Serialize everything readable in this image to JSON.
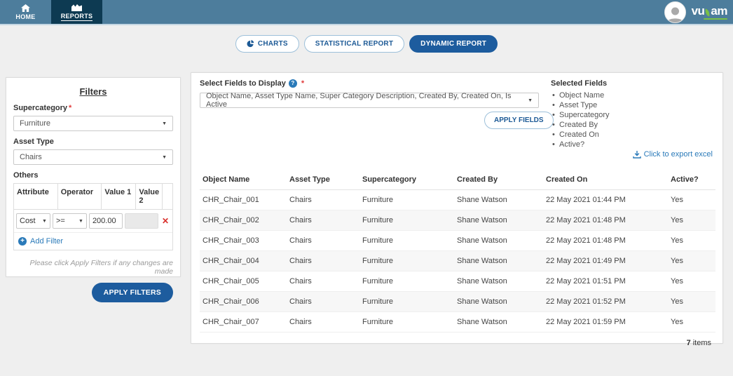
{
  "nav": {
    "home_label": "HOME",
    "reports_label": "REPORTS",
    "brand": {
      "part1": "vu",
      "part2": "am"
    }
  },
  "tabs": {
    "charts": "CHARTS",
    "statistical": "STATISTICAL REPORT",
    "dynamic": "DYNAMIC REPORT"
  },
  "filters": {
    "title": "Filters",
    "supercategory_label": "Supercategory",
    "supercategory_value": "Furniture",
    "asset_type_label": "Asset Type",
    "asset_type_value": "Chairs",
    "others_label": "Others",
    "others_columns": {
      "attribute": "Attribute",
      "operator": "Operator",
      "value1": "Value 1",
      "value2": "Value 2"
    },
    "filter_row": {
      "attribute": "Cost",
      "operator": ">=",
      "value1": "200.00"
    },
    "add_filter_label": "Add Filter",
    "note": "Please click Apply Filters if any changes are made",
    "apply_button": "APPLY FILTERS"
  },
  "fields_panel": {
    "select_label": "Select Fields to Display",
    "select_value": "Object Name, Asset Type Name, Super Category Description, Created By, Created On, Is Active",
    "apply_button": "APPLY FIELDS",
    "selected_fields_title": "Selected Fields",
    "selected_fields": [
      "Object Name",
      "Asset Type",
      "Supercategory",
      "Created By",
      "Created On",
      "Active?"
    ],
    "export_label": "Click to export excel"
  },
  "table": {
    "columns": [
      "Object Name",
      "Asset Type",
      "Supercategory",
      "Created By",
      "Created On",
      "Active?"
    ],
    "rows": [
      [
        "CHR_Chair_001",
        "Chairs",
        "Furniture",
        "Shane Watson",
        "22 May 2021 01:44 PM",
        "Yes"
      ],
      [
        "CHR_Chair_002",
        "Chairs",
        "Furniture",
        "Shane Watson",
        "22 May 2021 01:48 PM",
        "Yes"
      ],
      [
        "CHR_Chair_003",
        "Chairs",
        "Furniture",
        "Shane Watson",
        "22 May 2021 01:48 PM",
        "Yes"
      ],
      [
        "CHR_Chair_004",
        "Chairs",
        "Furniture",
        "Shane Watson",
        "22 May 2021 01:49 PM",
        "Yes"
      ],
      [
        "CHR_Chair_005",
        "Chairs",
        "Furniture",
        "Shane Watson",
        "22 May 2021 01:51 PM",
        "Yes"
      ],
      [
        "CHR_Chair_006",
        "Chairs",
        "Furniture",
        "Shane Watson",
        "22 May 2021 01:52 PM",
        "Yes"
      ],
      [
        "CHR_Chair_007",
        "Chairs",
        "Furniture",
        "Shane Watson",
        "22 May 2021 01:59 PM",
        "Yes"
      ]
    ],
    "footer_count": "7",
    "footer_label": "items"
  },
  "colors": {
    "navbar": "#4d7d9c",
    "navbar_active": "#0d3a52",
    "accent_blue": "#1d5c9e",
    "link_blue": "#2a7ab9",
    "brand_green": "#7ac143",
    "danger_red": "#d9302c"
  }
}
